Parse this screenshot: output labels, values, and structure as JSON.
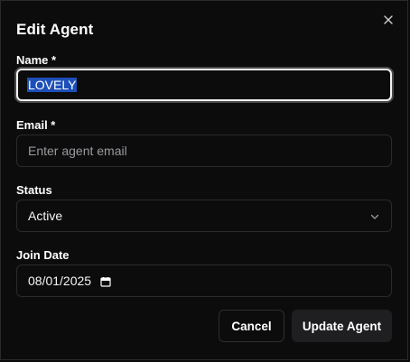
{
  "dialog": {
    "title": "Edit Agent",
    "close_icon": "close-icon"
  },
  "form": {
    "name": {
      "label": "Name *",
      "value": "LOVELY"
    },
    "email": {
      "label": "Email *",
      "placeholder": "Enter agent email",
      "value": ""
    },
    "status": {
      "label": "Status",
      "value": "Active",
      "icon": "chevron-down-icon"
    },
    "join_date": {
      "label": "Join Date",
      "value": "08/01/2025",
      "icon": "calendar-icon"
    }
  },
  "actions": {
    "cancel_label": "Cancel",
    "update_label": "Update Agent"
  },
  "colors": {
    "background": "#0c0c0d",
    "border": "#2b2b2e",
    "selection": "#1d4fb8",
    "text": "#ffffff",
    "placeholder": "#9a9a9f",
    "primary_button": "#1f1f21"
  }
}
